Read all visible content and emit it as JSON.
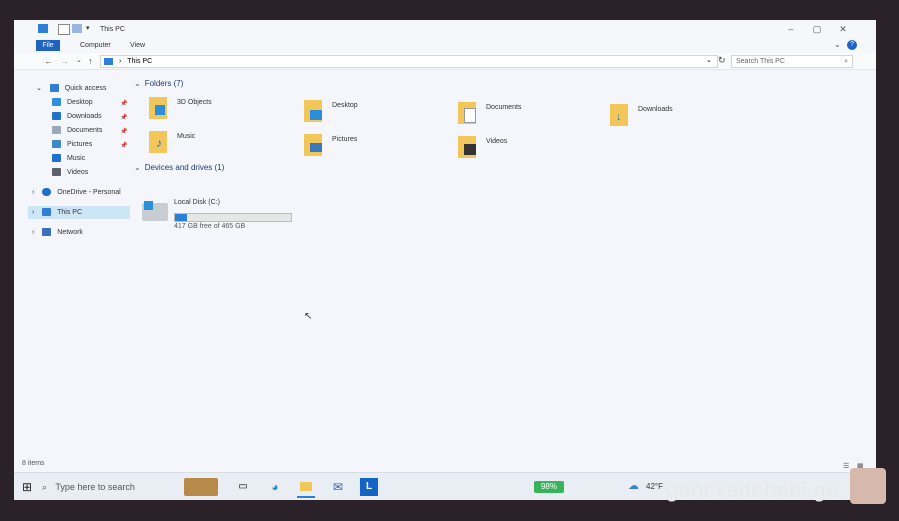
{
  "window": {
    "title": "This PC"
  },
  "ribbon": {
    "tabs": [
      "File",
      "Computer",
      "View"
    ]
  },
  "address": {
    "path": "This PC",
    "search_placeholder": "Search This PC"
  },
  "sidebar": {
    "quick_access": "Quick access",
    "items": [
      "Desktop",
      "Downloads",
      "Documents",
      "Pictures",
      "Music",
      "Videos"
    ],
    "onedrive": "OneDrive - Personal",
    "this_pc": "This PC",
    "network": "Network"
  },
  "folders": {
    "header": "Folders (7)",
    "items": [
      "3D Objects",
      "Desktop",
      "Documents",
      "Downloads",
      "Music",
      "Pictures",
      "Videos"
    ]
  },
  "drives": {
    "header": "Devices and drives (1)",
    "items": [
      {
        "name": "Local Disk (C:)",
        "free_text": "417 GB free of 465 GB",
        "used_fraction": 0.1
      }
    ]
  },
  "status": {
    "items": "8 items"
  },
  "taskbar": {
    "search_placeholder": "Type here to search",
    "battery": "98%",
    "weather": "42°F"
  },
  "watermark": "gancxadebebi.ge"
}
